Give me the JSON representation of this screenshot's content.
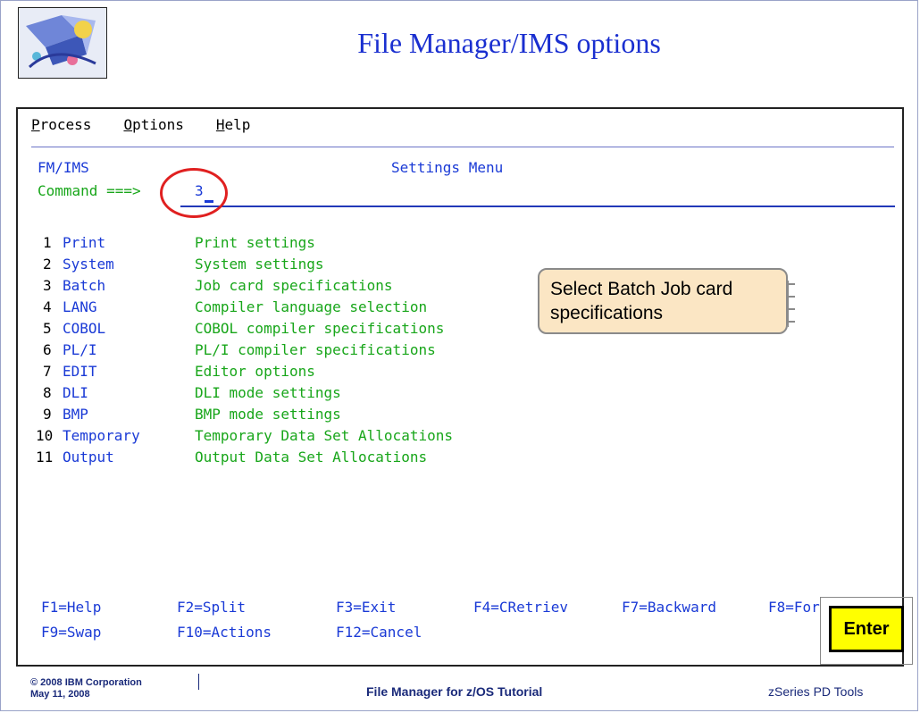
{
  "slide": {
    "title": "File Manager/IMS options",
    "callout": "Select Batch Job card specifications",
    "enter_label": "Enter",
    "footer_copyright": "© 2008 IBM Corporation",
    "footer_date": "May 11, 2008",
    "footer_center": "File Manager for z/OS Tutorial",
    "footer_right": "zSeries PD Tools"
  },
  "menubar": {
    "items": [
      {
        "hotkey": "P",
        "rest": "rocess"
      },
      {
        "hotkey": "O",
        "rest": "ptions"
      },
      {
        "hotkey": "H",
        "rest": "elp"
      }
    ]
  },
  "panel": {
    "product": "FM/IMS",
    "title": "Settings Menu",
    "command_label": "Command ===>",
    "command_value": "3"
  },
  "options": [
    {
      "num": "1",
      "key": "Print",
      "desc": "Print settings"
    },
    {
      "num": "2",
      "key": "System",
      "desc": "System settings"
    },
    {
      "num": "3",
      "key": "Batch",
      "desc": "Job card specifications"
    },
    {
      "num": "4",
      "key": "LANG",
      "desc": "Compiler language selection"
    },
    {
      "num": "5",
      "key": "COBOL",
      "desc": "COBOL compiler specifications"
    },
    {
      "num": "6",
      "key": "PL/I",
      "desc": "PL/I compiler specifications"
    },
    {
      "num": "7",
      "key": "EDIT",
      "desc": "Editor options"
    },
    {
      "num": "8",
      "key": "DLI",
      "desc": "DLI mode settings"
    },
    {
      "num": "9",
      "key": "BMP",
      "desc": "BMP mode settings"
    },
    {
      "num": "10",
      "key": "Temporary",
      "desc": "Temporary Data Set Allocations"
    },
    {
      "num": "11",
      "key": "Output",
      "desc": "Output Data Set Allocations"
    }
  ],
  "function_keys": {
    "row1": [
      "F1=Help",
      "F2=Split",
      "F3=Exit",
      "F4=CRetriev",
      "F7=Backward",
      "F8=For"
    ],
    "row2": [
      "F9=Swap",
      "F10=Actions",
      "F12=Cancel"
    ]
  },
  "colors": {
    "terminal_blue": "#1a3ad6",
    "terminal_green": "#18a61a",
    "title_blue": "#1a2fd0",
    "highlight_red": "#e02020",
    "enter_yellow": "#ffff00"
  }
}
